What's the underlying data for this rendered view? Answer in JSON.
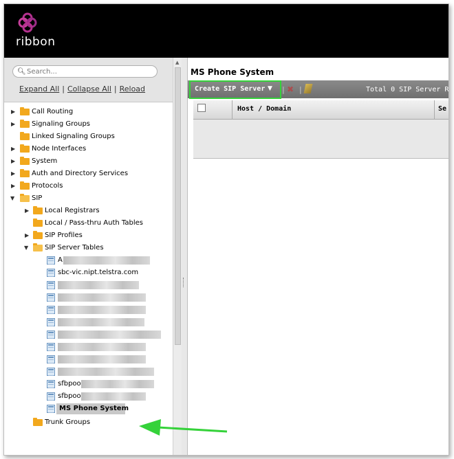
{
  "header": {
    "logo_text": "ribbon"
  },
  "sidebar": {
    "search_placeholder": "Search...",
    "links": {
      "expand_all": "Expand All",
      "collapse_all": "Collapse All",
      "reload": "Reload",
      "separator": "|"
    }
  },
  "tree": {
    "call_routing": "Call Routing",
    "signaling_groups": "Signaling Groups",
    "linked_signaling_groups": "Linked Signaling Groups",
    "node_interfaces": "Node Interfaces",
    "system": "System",
    "auth_directory": "Auth and Directory Services",
    "protocols": "Protocols",
    "sip": "SIP",
    "local_registrars": "Local Registrars",
    "local_passthru": "Local / Pass-thru Auth Tables",
    "sip_profiles": "SIP Profiles",
    "sip_server_tables": "SIP Server Tables",
    "server_tables": {
      "item_a": "A",
      "item_telstra": "sbc-vic.nipt.telstra.com",
      "item_sfbpoo_1": "sfbpoo",
      "item_sfbpoo_2": "sfbpoo",
      "item_ms_phone": "MS Phone System"
    },
    "trunk_groups": "Trunk Groups"
  },
  "main": {
    "title": "MS Phone System",
    "toolbar": {
      "create_label": "Create SIP Server",
      "separator": "|",
      "total_text": "Total 0 SIP Server R"
    },
    "table": {
      "col_host": "Host / Domain",
      "col_se": "Se"
    }
  },
  "colors": {
    "highlight": "#35d23a",
    "logo_accent": "#b5318f"
  }
}
